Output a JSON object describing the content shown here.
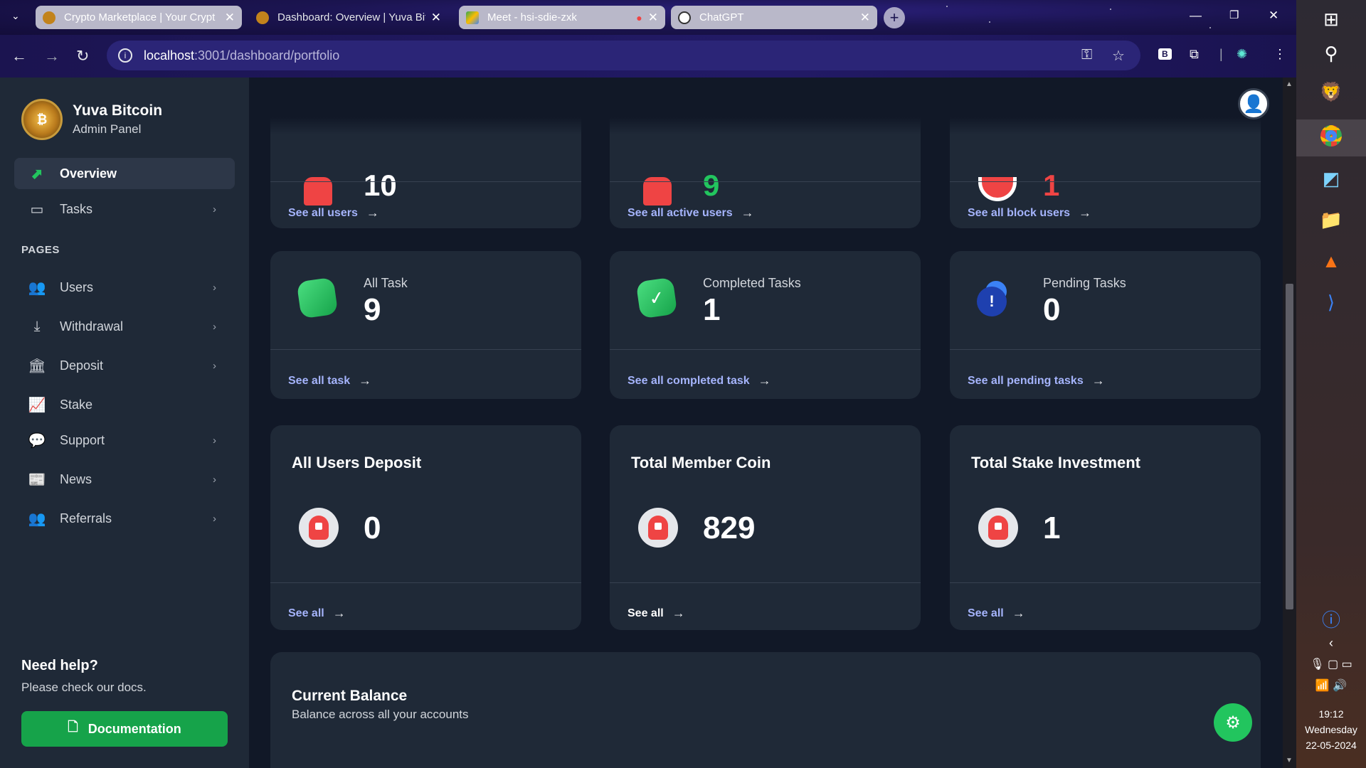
{
  "browser": {
    "tabs": [
      {
        "title": "Crypto Marketplace | Your Crypt",
        "color": "#c2831c"
      },
      {
        "title": "Dashboard: Overview | Yuva Bit",
        "color": "#c2831c"
      },
      {
        "title": "Meet - hsi-sdie-zxk",
        "color": "#34a853"
      },
      {
        "title": "ChatGPT",
        "color": "#ffffff"
      }
    ],
    "url_host": "localhost",
    "url_path": ":3001/dashboard/portfolio"
  },
  "sidebar": {
    "brand_title": "Yuva Bitcoin",
    "brand_subtitle": "Admin Panel",
    "overview": "Overview",
    "tasks": "Tasks",
    "pages_label": "PAGES",
    "items": [
      {
        "label": "Users",
        "icon": "users-icon"
      },
      {
        "label": "Withdrawal",
        "icon": "withdraw-icon"
      },
      {
        "label": "Deposit",
        "icon": "bank-icon"
      },
      {
        "label": "Stake",
        "icon": "chart-icon"
      },
      {
        "label": "Support",
        "icon": "chat-icon"
      },
      {
        "label": "News",
        "icon": "newspaper-icon"
      },
      {
        "label": "Referrals",
        "icon": "users-icon"
      }
    ],
    "help_title": "Need help?",
    "help_subtitle": "Please check our docs.",
    "doc_button": "Documentation"
  },
  "main": {
    "row1": [
      {
        "value": "10",
        "link": "See all users",
        "value_color": "#ffffff"
      },
      {
        "value": "9",
        "link": "See all active users",
        "value_color": "#22c55e"
      },
      {
        "value": "1",
        "link": "See all block users",
        "value_color": "#ef4444"
      }
    ],
    "row2": [
      {
        "label": "All Task",
        "value": "9",
        "link": "See all task"
      },
      {
        "label": "Completed Tasks",
        "value": "1",
        "link": "See all completed task"
      },
      {
        "label": "Pending Tasks",
        "value": "0",
        "link": "See all pending tasks"
      }
    ],
    "row3": [
      {
        "title": "All Users Deposit",
        "value": "0",
        "link": "See all"
      },
      {
        "title": "Total Member Coin",
        "value": "829",
        "link": "See all"
      },
      {
        "title": "Total Stake Investment",
        "value": "1",
        "link": "See all"
      }
    ],
    "balance_title": "Current Balance",
    "balance_subtitle": "Balance across all your accounts"
  },
  "taskbar": {
    "time": "19:12",
    "day": "Wednesday",
    "date": "22-05-2024"
  }
}
